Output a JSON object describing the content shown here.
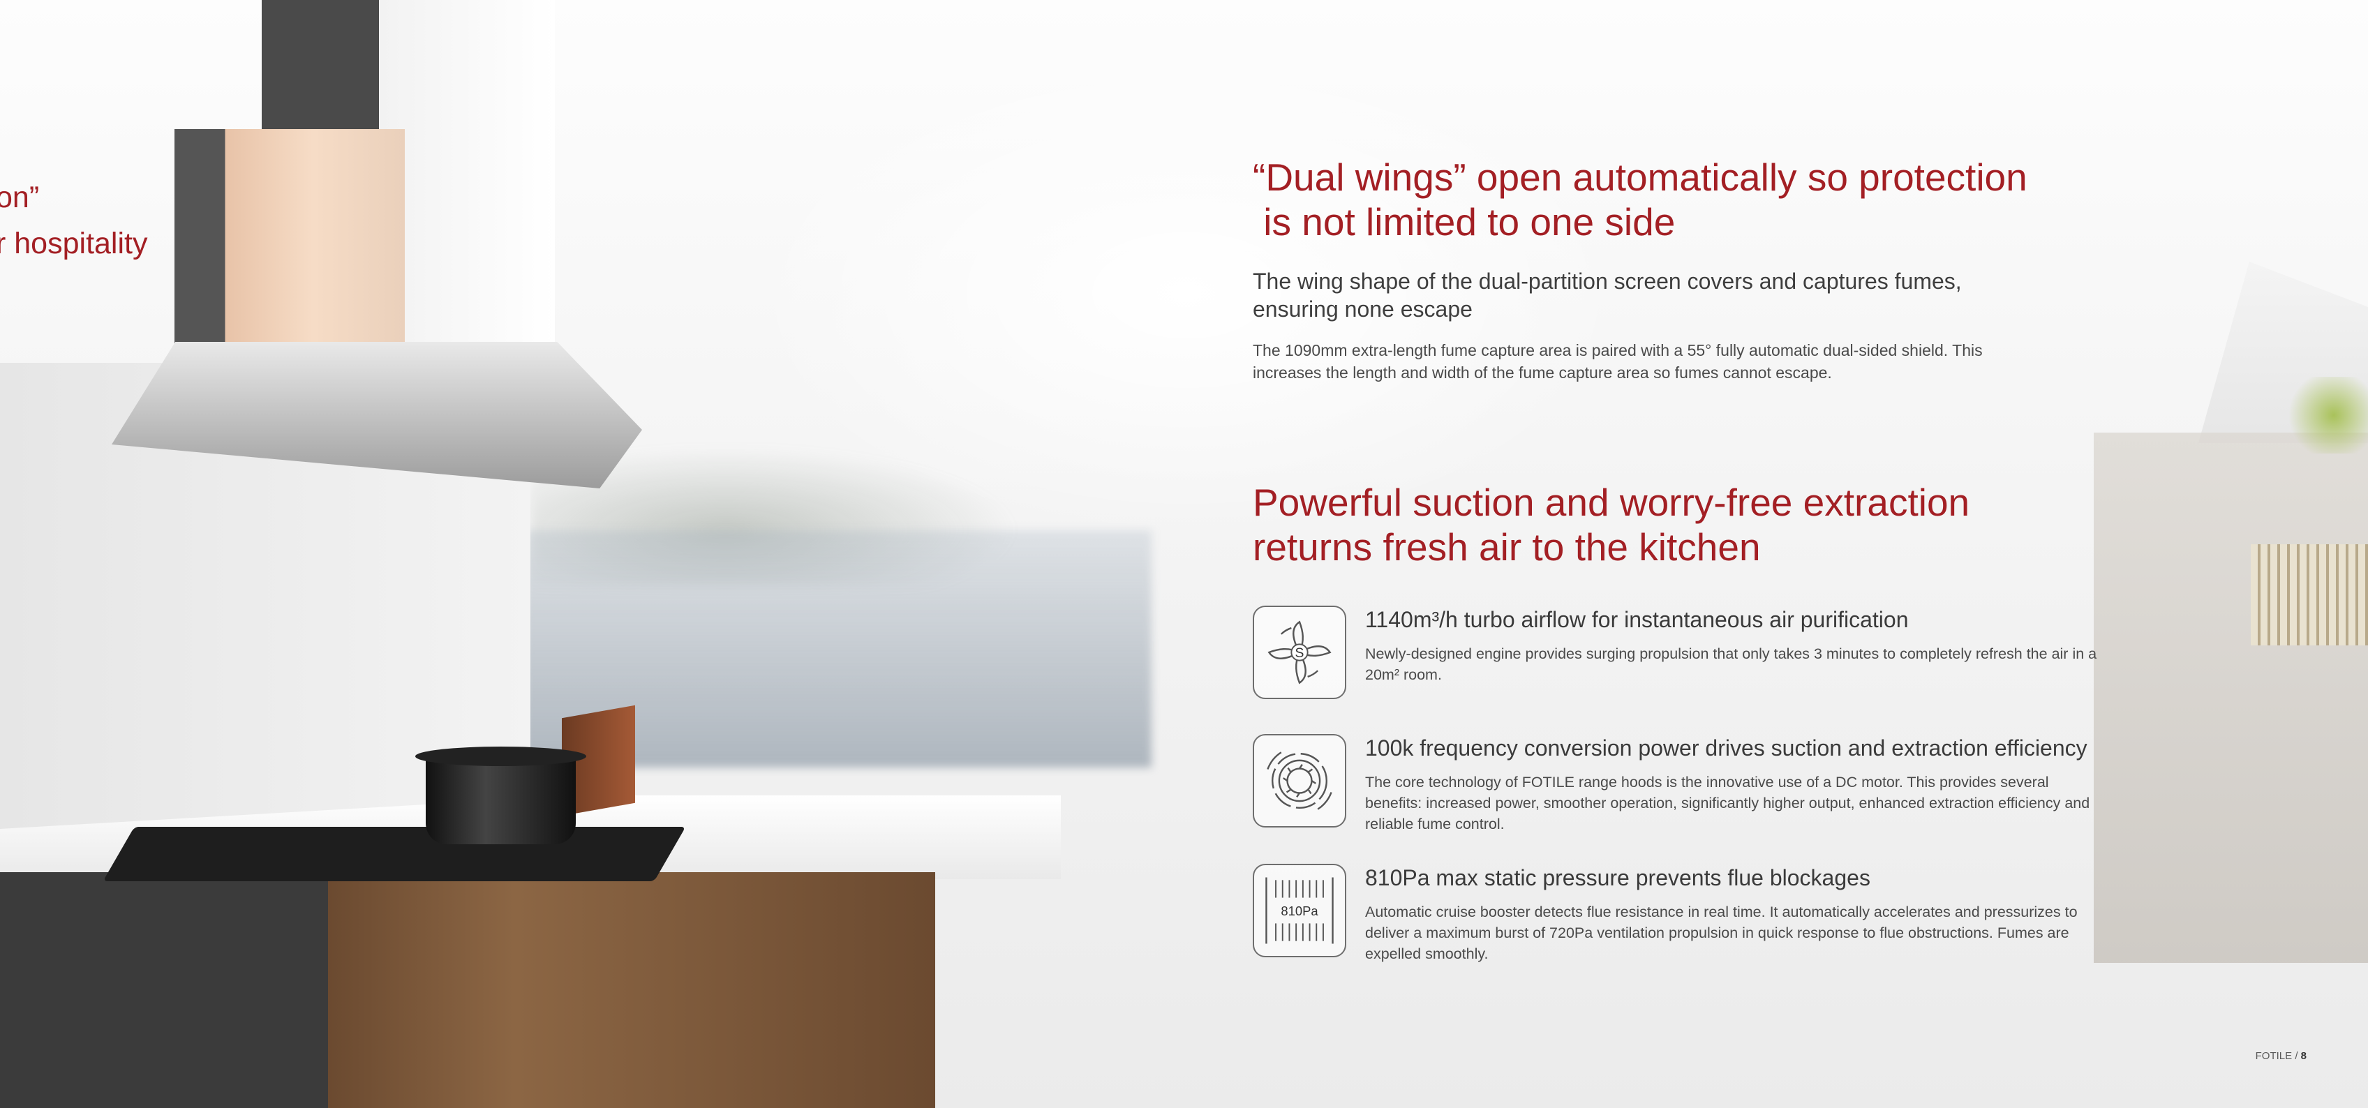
{
  "left_heading": {
    "line1": "on”",
    "line2": "r hospitality"
  },
  "section1": {
    "title_line1": "“Dual wings” open automatically so protection",
    "title_line2": " is not limited to one side",
    "subtitle": "The wing shape of the dual-partition screen covers and captures fumes, ensuring none escape",
    "body": "The 1090mm extra-length fume capture area is paired with a 55° fully automatic dual-sided shield. This increases the length and width of the fume capture area so fumes cannot escape."
  },
  "section2": {
    "title_line1": "Powerful suction and worry-free extraction",
    "title_line2": "returns fresh air to the kitchen",
    "features": [
      {
        "icon": "turbo-fan-icon",
        "icon_label": "S",
        "title": "1140m³/h turbo airflow for instantaneous air purification",
        "desc": "Newly-designed engine provides surging propulsion that only takes 3 minutes to completely refresh the air in a 20m² room."
      },
      {
        "icon": "dc-motor-icon",
        "title": "100k frequency conversion power drives suction and extraction efficiency",
        "desc": "The core technology of FOTILE range hoods is the innovative use of a DC motor. This provides several benefits: increased power, smoother operation, significantly higher output, enhanced extraction efficiency and reliable fume control."
      },
      {
        "icon": "static-pressure-icon",
        "icon_label": "810Pa",
        "title": "810Pa max static pressure prevents flue blockages",
        "desc": "Automatic cruise booster detects flue resistance in real time. It automatically accelerates and pressurizes to deliver a maximum burst of 720Pa ventilation propulsion in quick response to flue obstructions. Fumes are expelled smoothly."
      }
    ]
  },
  "footer": {
    "brand": "FOTILE /",
    "page": "8"
  },
  "colors": {
    "accent": "#a31f24",
    "text": "#3e3e3e"
  }
}
